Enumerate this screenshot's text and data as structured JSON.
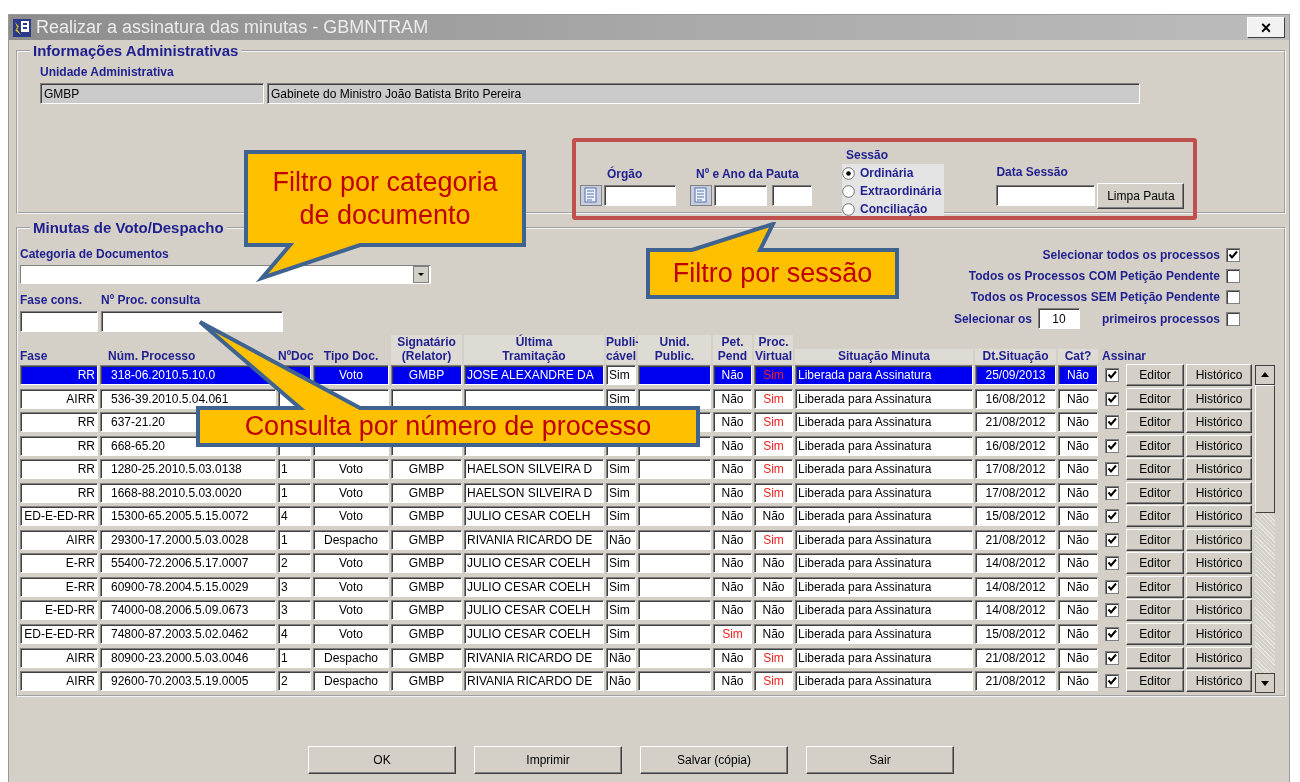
{
  "window": {
    "title": "Realizar a assinatura das minutas - GBMNTRAM",
    "close_label": "×"
  },
  "admin": {
    "legend": "Informações Administrativas",
    "unit_label": "Unidade Administrativa",
    "unit_code": "GMBP",
    "unit_name": "Gabinete do Ministro João Batista Brito Pereira"
  },
  "session_filter": {
    "orgao_label": "Órgão",
    "pauta_label": "Nº e Ano da Pauta",
    "sessao_label": "Sessão",
    "data_label": "Data Sessão",
    "clear_button": "Limpa Pauta",
    "options": [
      {
        "label": "Ordinária",
        "selected": true
      },
      {
        "label": "Extraordinária",
        "selected": false
      },
      {
        "label": "Conciliação",
        "selected": false
      }
    ]
  },
  "minutas": {
    "legend": "Minutas de Voto/Despacho",
    "category_label": "Categoria de Documentos",
    "fase_label": "Fase cons.",
    "proc_label": "Nº Proc. consulta",
    "options": [
      {
        "kind": "checkbox",
        "label": "Selecionar todos os processos",
        "checked": true
      },
      {
        "kind": "checkbox",
        "label": "Todos os Processos COM Petição Pendente",
        "checked": false
      },
      {
        "kind": "checkbox",
        "label": "Todos os Processos SEM Petição Pendente",
        "checked": false
      },
      {
        "kind": "count",
        "label": "Selecionar os",
        "value": "10",
        "suffix": "primeiros processos",
        "checked": false
      }
    ],
    "columns": [
      "Fase",
      "Núm. Processo",
      "NºDoc",
      "Tipo Doc.",
      "Signatário\n(Relator)",
      "Última\nTramitação",
      "Publi-\ncável",
      "Unid.\nPublic.",
      "Pet.\nPend",
      "Proc.\nVirtual",
      "Situação Minuta",
      "Dt.Situação",
      "Cat?",
      "Assinar"
    ],
    "rows": [
      {
        "selected": true,
        "fase": "RR",
        "processo": "318-06.2010.5.10.0",
        "tipo": "Voto",
        "signatario": "GMBP",
        "tramitacao": "JOSE ALEXANDRE DA",
        "publicavel": "Sim",
        "pet": {
          "text": "Não",
          "highlighted": false
        },
        "proc": {
          "text": "Sim",
          "highlighted": true
        },
        "situacao": "Liberada para Assinatura",
        "data": "25/09/2013",
        "cat": "Não",
        "signed": true,
        "editor": "Editor",
        "historico": "Histórico"
      },
      {
        "selected": false,
        "fase": "AIRR",
        "processo": "536-39.2010.5.04.061",
        "publicavel": "Sim",
        "pet": {
          "text": "Não",
          "highlighted": false
        },
        "proc": {
          "text": "Sim",
          "highlighted": true
        },
        "situacao": "Liberada para Assinatura",
        "data": "16/08/2012",
        "cat": "Não",
        "signed": true,
        "editor": "Editor",
        "historico": "Histórico"
      },
      {
        "selected": false,
        "fase": "RR",
        "processo": "637-21.20",
        "pet": {
          "text": "Não",
          "highlighted": false
        },
        "proc": {
          "text": "Sim",
          "highlighted": true
        },
        "situacao": "Liberada para Assinatura",
        "data": "21/08/2012",
        "cat": "Não",
        "signed": true,
        "editor": "Editor",
        "historico": "Histórico"
      },
      {
        "selected": false,
        "fase": "RR",
        "processo": "668-65.20",
        "pet": {
          "text": "Não",
          "highlighted": false
        },
        "proc": {
          "text": "Sim",
          "highlighted": true
        },
        "situacao": "Liberada para Assinatura",
        "data": "16/08/2012",
        "cat": "Não",
        "signed": true,
        "editor": "Editor",
        "historico": "Histórico"
      },
      {
        "selected": false,
        "fase": "RR",
        "processo": "1280-25.2010.5.03.0138",
        "doc": "1",
        "tipo": "Voto",
        "signatario": "GMBP",
        "tramitacao": "HAELSON SILVEIRA D",
        "publicavel": "Sim",
        "pet": {
          "text": "Não",
          "highlighted": false
        },
        "proc": {
          "text": "Sim",
          "highlighted": true
        },
        "situacao": "Liberada para Assinatura",
        "data": "17/08/2012",
        "cat": "Não",
        "signed": true,
        "editor": "Editor",
        "historico": "Histórico"
      },
      {
        "selected": false,
        "fase": "RR",
        "processo": "1668-88.2010.5.03.0020",
        "doc": "1",
        "tipo": "Voto",
        "signatario": "GMBP",
        "tramitacao": "HAELSON SILVEIRA D",
        "publicavel": "Sim",
        "pet": {
          "text": "Não",
          "highlighted": false
        },
        "proc": {
          "text": "Sim",
          "highlighted": true
        },
        "situacao": "Liberada para Assinatura",
        "data": "17/08/2012",
        "cat": "Não",
        "signed": true,
        "editor": "Editor",
        "historico": "Histórico"
      },
      {
        "selected": false,
        "fase": "ED-E-ED-RR",
        "processo": "15300-65.2005.5.15.0072",
        "doc": "4",
        "tipo": "Voto",
        "signatario": "GMBP",
        "tramitacao": "JULIO CESAR COELH",
        "publicavel": "Sim",
        "pet": {
          "text": "Não",
          "highlighted": false
        },
        "proc": {
          "text": "Não",
          "highlighted": false
        },
        "situacao": "Liberada para Assinatura",
        "data": "15/08/2012",
        "cat": "Não",
        "signed": true,
        "editor": "Editor",
        "historico": "Histórico"
      },
      {
        "selected": false,
        "fase": "AIRR",
        "processo": "29300-17.2000.5.03.0028",
        "doc": "1",
        "tipo": "Despacho",
        "signatario": "GMBP",
        "tramitacao": "RIVANIA RICARDO DE",
        "publicavel": "Não",
        "pet": {
          "text": "Não",
          "highlighted": false
        },
        "proc": {
          "text": "Sim",
          "highlighted": true
        },
        "situacao": "Liberada para Assinatura",
        "data": "21/08/2012",
        "cat": "Não",
        "signed": true,
        "editor": "Editor",
        "historico": "Histórico"
      },
      {
        "selected": false,
        "fase": "E-RR",
        "processo": "55400-72.2006.5.17.0007",
        "doc": "2",
        "tipo": "Voto",
        "signatario": "GMBP",
        "tramitacao": "JULIO CESAR COELH",
        "publicavel": "Sim",
        "pet": {
          "text": "Não",
          "highlighted": false
        },
        "proc": {
          "text": "Não",
          "highlighted": false
        },
        "situacao": "Liberada para Assinatura",
        "data": "14/08/2012",
        "cat": "Não",
        "signed": true,
        "editor": "Editor",
        "historico": "Histórico"
      },
      {
        "selected": false,
        "fase": "E-RR",
        "processo": "60900-78.2004.5.15.0029",
        "doc": "3",
        "tipo": "Voto",
        "signatario": "GMBP",
        "tramitacao": "JULIO CESAR COELH",
        "publicavel": "Sim",
        "pet": {
          "text": "Não",
          "highlighted": false
        },
        "proc": {
          "text": "Não",
          "highlighted": false
        },
        "situacao": "Liberada para Assinatura",
        "data": "14/08/2012",
        "cat": "Não",
        "signed": true,
        "editor": "Editor",
        "historico": "Histórico"
      },
      {
        "selected": false,
        "fase": "E-ED-RR",
        "processo": "74000-08.2006.5.09.0673",
        "doc": "3",
        "tipo": "Voto",
        "signatario": "GMBP",
        "tramitacao": "JULIO CESAR COELH",
        "publicavel": "Sim",
        "pet": {
          "text": "Não",
          "highlighted": false
        },
        "proc": {
          "text": "Não",
          "highlighted": false
        },
        "situacao": "Liberada para Assinatura",
        "data": "14/08/2012",
        "cat": "Não",
        "signed": true,
        "editor": "Editor",
        "historico": "Histórico"
      },
      {
        "selected": false,
        "fase": "ED-E-ED-RR",
        "processo": "74800-87.2003.5.02.0462",
        "doc": "4",
        "tipo": "Voto",
        "signatario": "GMBP",
        "tramitacao": "JULIO CESAR COELH",
        "publicavel": "Sim",
        "pet": {
          "text": "Sim",
          "highlighted": true
        },
        "proc": {
          "text": "Não",
          "highlighted": false
        },
        "situacao": "Liberada para Assinatura",
        "data": "15/08/2012",
        "cat": "Não",
        "signed": true,
        "editor": "Editor",
        "historico": "Histórico"
      },
      {
        "selected": false,
        "fase": "AIRR",
        "processo": "80900-23.2000.5.03.0046",
        "doc": "1",
        "tipo": "Despacho",
        "signatario": "GMBP",
        "tramitacao": "RIVANIA RICARDO DE",
        "publicavel": "Não",
        "pet": {
          "text": "Não",
          "highlighted": false
        },
        "proc": {
          "text": "Sim",
          "highlighted": true
        },
        "situacao": "Liberada para Assinatura",
        "data": "21/08/2012",
        "cat": "Não",
        "signed": true,
        "editor": "Editor",
        "historico": "Histórico"
      },
      {
        "selected": false,
        "fase": "AIRR",
        "processo": "92600-70.2003.5.19.0005",
        "doc": "2",
        "tipo": "Despacho",
        "signatario": "GMBP",
        "tramitacao": "RIVANIA RICARDO DE",
        "publicavel": "Não",
        "pet": {
          "text": "Não",
          "highlighted": false
        },
        "proc": {
          "text": "Sim",
          "highlighted": true
        },
        "situacao": "Liberada para Assinatura",
        "data": "21/08/2012",
        "cat": "Não",
        "signed": true,
        "editor": "Editor",
        "historico": "Histórico"
      }
    ]
  },
  "buttons": [
    "OK",
    "Imprimir",
    "Salvar (cópia)",
    "Sair"
  ],
  "annotations": [
    {
      "kind": "callout",
      "text": "Filtro por categoria de documento"
    },
    {
      "kind": "callout",
      "text": "Filtro por sessão"
    },
    {
      "kind": "callout",
      "text": "Consulta por número de processo"
    }
  ]
}
